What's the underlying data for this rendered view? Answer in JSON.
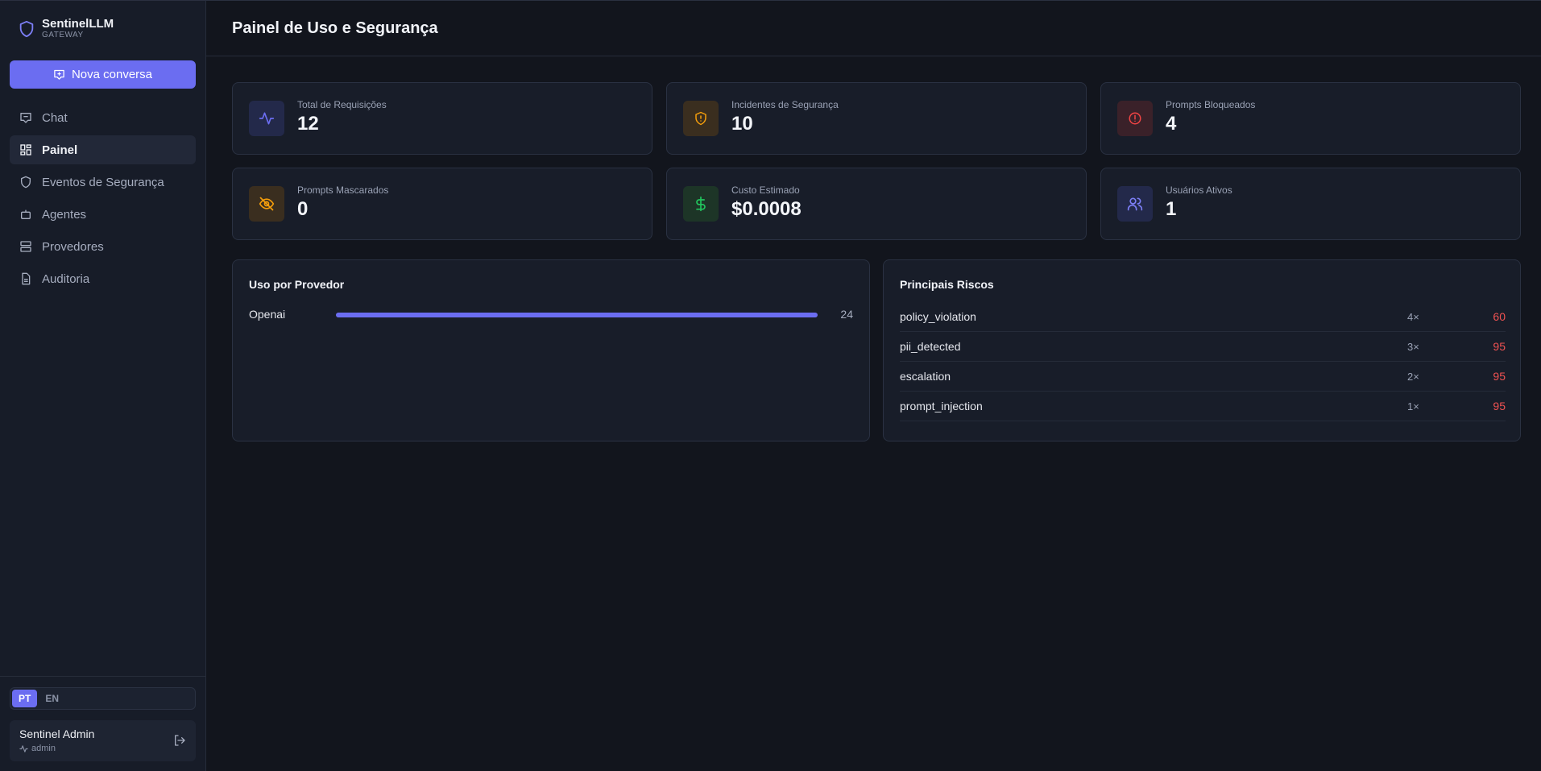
{
  "app": {
    "name": "SentinelLLM",
    "subtitle": "GATEWAY"
  },
  "sidebar": {
    "new_chat_label": "Nova conversa",
    "items": [
      {
        "label": "Chat",
        "icon": "chat-icon"
      },
      {
        "label": "Painel",
        "icon": "dashboard-icon",
        "active": true
      },
      {
        "label": "Eventos de Segurança",
        "icon": "shield-icon"
      },
      {
        "label": "Agentes",
        "icon": "bot-icon"
      },
      {
        "label": "Provedores",
        "icon": "server-icon"
      },
      {
        "label": "Auditoria",
        "icon": "file-icon"
      }
    ],
    "languages": [
      "PT",
      "EN"
    ],
    "active_language": "PT",
    "user": {
      "name": "Sentinel Admin",
      "role": "admin"
    }
  },
  "header": {
    "title": "Painel de Uso e Segurança"
  },
  "stats": [
    {
      "label": "Total de Requisições",
      "value": "12",
      "icon": "activity-icon",
      "color": "#6b6df1"
    },
    {
      "label": "Incidentes de Segurança",
      "value": "10",
      "icon": "shield-alert-icon",
      "color": "#f59e0b"
    },
    {
      "label": "Prompts Bloqueados",
      "value": "4",
      "icon": "alert-circle-icon",
      "color": "#ef4444"
    },
    {
      "label": "Prompts Mascarados",
      "value": "0",
      "icon": "eye-off-icon",
      "color": "#f59e0b"
    },
    {
      "label": "Custo Estimado",
      "value": "$0.0008",
      "icon": "dollar-icon",
      "color": "#22c55e"
    },
    {
      "label": "Usuários Ativos",
      "value": "1",
      "icon": "users-icon",
      "color": "#6b6df1"
    }
  ],
  "usage": {
    "title": "Uso por Provedor",
    "providers": [
      {
        "name": "Openai",
        "value": "24",
        "fraction": 1.0
      }
    ]
  },
  "risks": {
    "title": "Principais Riscos",
    "items": [
      {
        "name": "policy_violation",
        "count": "4×",
        "score": "60"
      },
      {
        "name": "pii_detected",
        "count": "3×",
        "score": "95"
      },
      {
        "name": "escalation",
        "count": "2×",
        "score": "95"
      },
      {
        "name": "prompt_injection",
        "count": "1×",
        "score": "95"
      }
    ]
  }
}
